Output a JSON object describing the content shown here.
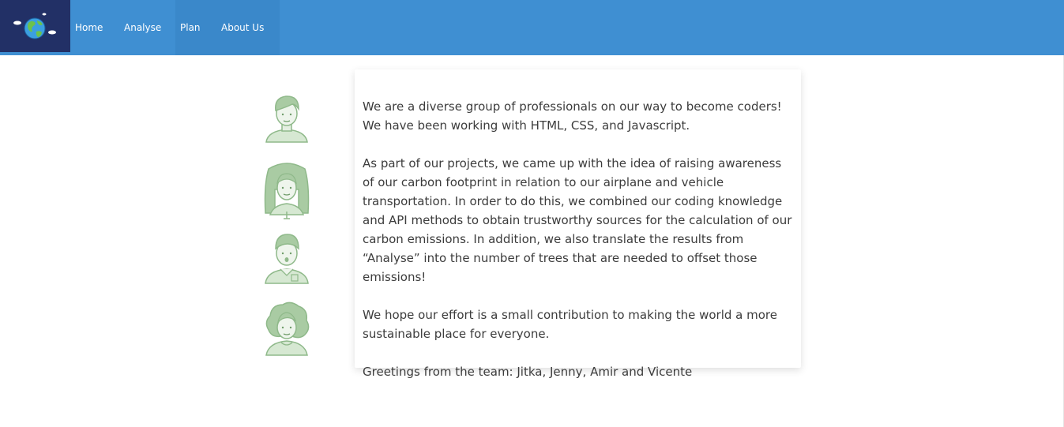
{
  "nav": {
    "logo_icon": "earth-globe-icon",
    "items": [
      {
        "label": "Home"
      },
      {
        "label": "Analyse"
      },
      {
        "label": "Plan"
      },
      {
        "label": "About Us"
      }
    ]
  },
  "team_avatars": [
    {
      "icon": "man-avatar-icon"
    },
    {
      "icon": "woman-long-hair-avatar-icon"
    },
    {
      "icon": "man-shirt-avatar-icon"
    },
    {
      "icon": "woman-curly-hair-avatar-icon"
    }
  ],
  "about": {
    "paragraphs": [
      "We are a diverse group of professionals on our way to become coders! We have been working with HTML, CSS, and Javascript.",
      "As part of our projects, we came up with the idea of raising awareness of our carbon footprint in relation to our airplane and vehicle transportation. In order to do this, we combined our coding knowledge and API methods to obtain trustworthy sources for the calculation of our carbon emissions. In addition, we also translate the results from “Analyse” into the number of trees that are needed to offset those emissions!",
      "We hope our effort is a small contribution to making the world a more sustainable place for everyone.",
      "Greetings from the team: Jitka, Jenny, Amir and Vicente"
    ]
  },
  "colors": {
    "navbar": "#3f8fd2",
    "logo_background": "#223066",
    "active_tab": "#3a88ca",
    "avatar_green": "#8fb98a",
    "text": "#3c3c3c"
  }
}
